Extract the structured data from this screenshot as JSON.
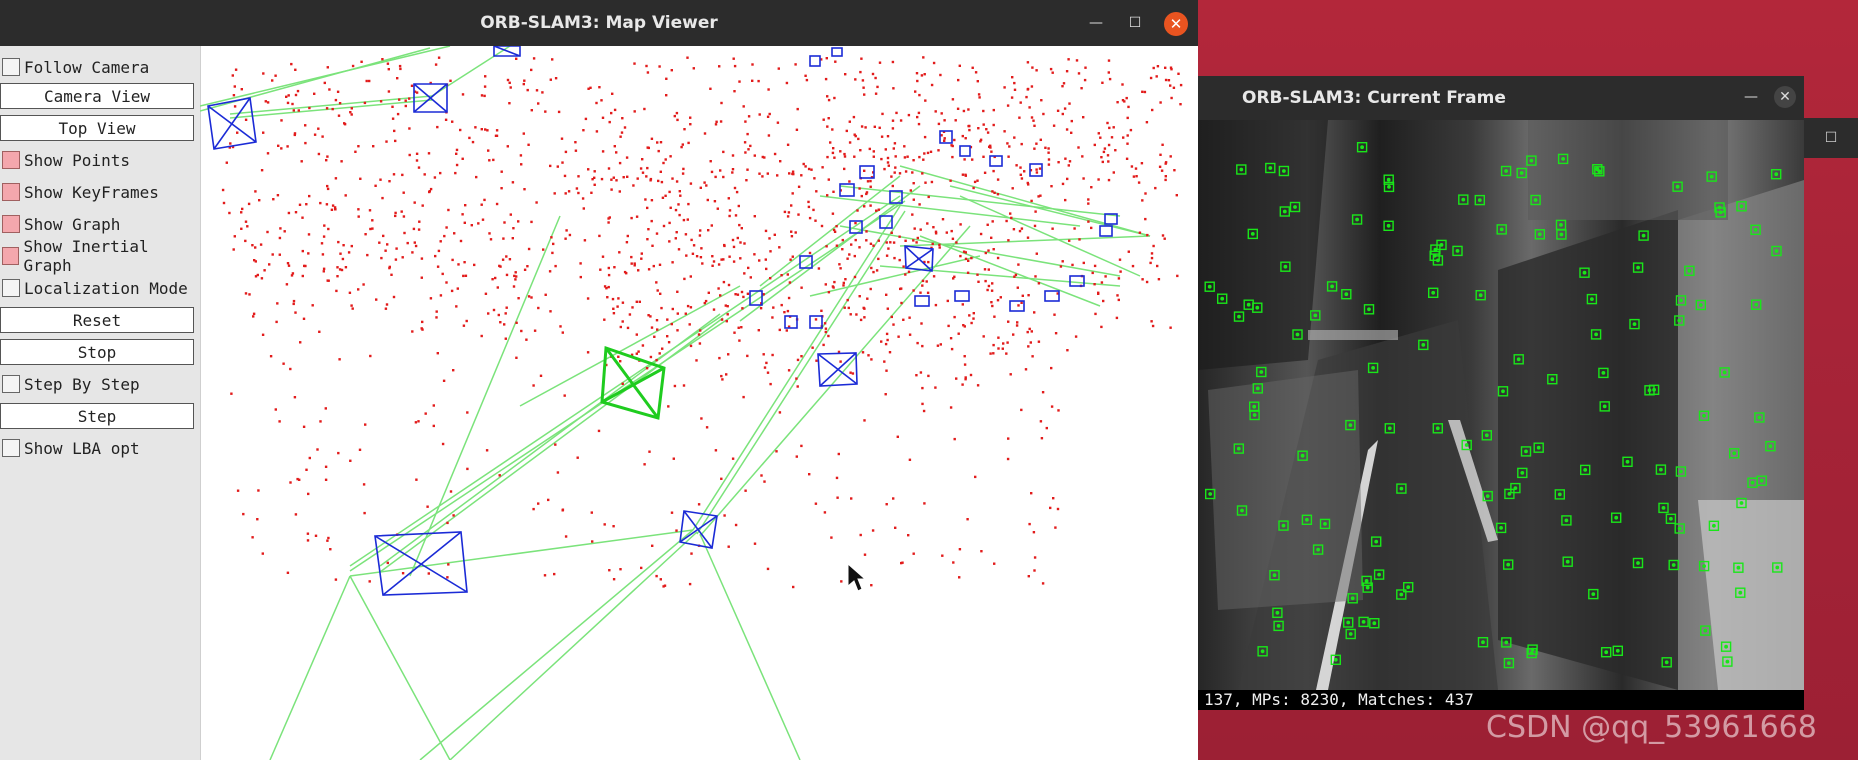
{
  "map_window": {
    "title": "ORB-SLAM3: Map Viewer",
    "controls": [
      {
        "type": "checkbox",
        "label": "Follow Camera",
        "checked": false
      },
      {
        "type": "button",
        "label": "Camera View"
      },
      {
        "type": "button",
        "label": "Top View"
      },
      {
        "type": "checkbox",
        "label": "Show Points",
        "checked": true
      },
      {
        "type": "checkbox",
        "label": "Show KeyFrames",
        "checked": true
      },
      {
        "type": "checkbox",
        "label": "Show Graph",
        "checked": true
      },
      {
        "type": "checkbox",
        "label": "Show Inertial Graph",
        "checked": true
      },
      {
        "type": "checkbox",
        "label": "Localization Mode",
        "checked": false
      },
      {
        "type": "button",
        "label": "Reset"
      },
      {
        "type": "button",
        "label": "Stop"
      },
      {
        "type": "checkbox",
        "label": "Step By Step",
        "checked": false
      },
      {
        "type": "button",
        "label": "Step"
      },
      {
        "type": "checkbox",
        "label": "Show LBA opt",
        "checked": false
      }
    ],
    "colors": {
      "points": "#e21b1b",
      "keyframes": "#1b2bd6",
      "graph": "#7be37b",
      "current_camera": "#1fcc1f"
    }
  },
  "frame_window": {
    "title": "ORB-SLAM3: Current Frame",
    "status": "137, MPs: 8230, Matches: 437",
    "feature_color": "#19e619"
  },
  "watermark": "CSDN @qq_53961668"
}
